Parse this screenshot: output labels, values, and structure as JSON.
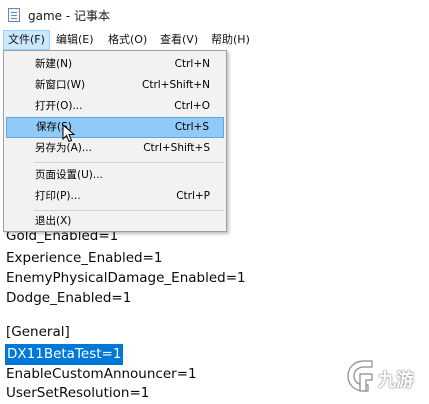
{
  "window": {
    "title": "game - 记事本"
  },
  "menubar": {
    "items": [
      {
        "label": "文件(F)",
        "active": true
      },
      {
        "label": "编辑(E)"
      },
      {
        "label": "格式(O)"
      },
      {
        "label": "查看(V)"
      },
      {
        "label": "帮助(H)"
      }
    ]
  },
  "file_menu": {
    "items": [
      {
        "label": "新建(N)",
        "shortcut": "Ctrl+N"
      },
      {
        "label": "新窗口(W)",
        "shortcut": "Ctrl+Shift+N"
      },
      {
        "label": "打开(O)...",
        "shortcut": "Ctrl+O"
      },
      {
        "label": "保存(S)",
        "shortcut": "Ctrl+S",
        "highlighted": true
      },
      {
        "label": "另存为(A)...",
        "shortcut": "Ctrl+Shift+S"
      },
      {
        "label": "页面设置(U)...",
        "shortcut": ""
      },
      {
        "label": "打印(P)...",
        "shortcut": "Ctrl+P"
      },
      {
        "label": "退出(X)",
        "shortcut": ""
      }
    ]
  },
  "editor": {
    "lines": [
      "Gold_Enabled=1",
      "Experience_Enabled=1",
      "EnemyPhysicalDamage_Enabled=1",
      "Dodge_Enabled=1",
      "",
      "[General]",
      "DX11BetaTest=1",
      "EnableCustomAnnouncer=1",
      "UserSetResolution=1"
    ],
    "selected_line": "DX11BetaTest=1"
  },
  "watermark": {
    "text": "九游",
    "color": "#ffffff"
  },
  "colors": {
    "selection": "#0078d7",
    "menu_highlight": "#91c9f7",
    "menubar_active": "#cce8ff"
  }
}
